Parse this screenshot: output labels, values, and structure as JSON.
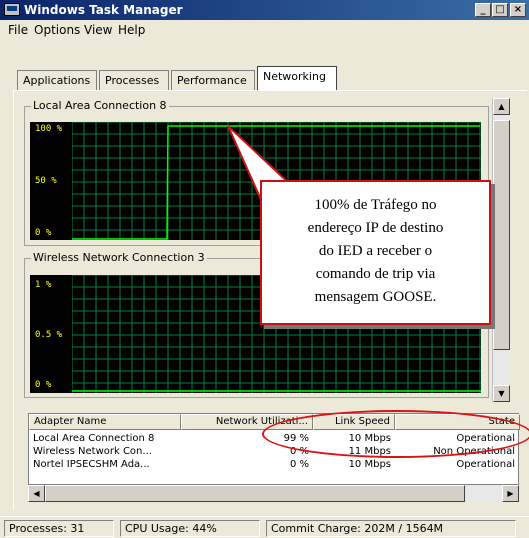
{
  "window": {
    "title": "Windows Task Manager",
    "minimize_label": "_",
    "maximize_label": "□",
    "close_label": "×"
  },
  "menu": [
    "File",
    "Options",
    "View",
    "Help"
  ],
  "tabs": [
    {
      "label": "Applications",
      "active": false
    },
    {
      "label": "Processes",
      "active": false
    },
    {
      "label": "Performance",
      "active": false
    },
    {
      "label": "Networking",
      "active": true
    }
  ],
  "graphs": [
    {
      "title": "Local Area Connection 8",
      "y_labels": [
        "100 %",
        "50 %",
        "0 %"
      ],
      "line_color": "#00ff00",
      "grid_color": "#008040"
    },
    {
      "title": "Wireless Network Connection 3",
      "y_labels": [
        "1 %",
        "0.5 %",
        "0 %"
      ],
      "line_color": "#00ff00",
      "grid_color": "#008040"
    }
  ],
  "callout": {
    "text_lines": [
      "100% de Tráfego no",
      "endereço IP de destino",
      "do IED a receber o",
      "comando de trip via",
      "mensagem GOOSE."
    ],
    "border_color": "#cc1111"
  },
  "adapter_table": {
    "columns": [
      "Adapter Name",
      "Network Utilizati...",
      "Link Speed",
      "State"
    ],
    "rows": [
      {
        "name": "Local Area Connection 8",
        "utilization": "99 %",
        "speed": "10 Mbps",
        "state": "Operational"
      },
      {
        "name": "Wireless Network Con...",
        "utilization": "0 %",
        "speed": "11 Mbps",
        "state": "Non Operational"
      },
      {
        "name": "Nortel IPSECSHM Ada...",
        "utilization": "0 %",
        "speed": "10 Mbps",
        "state": "Operational"
      }
    ]
  },
  "status": {
    "processes": "Processes: 31",
    "cpu": "CPU Usage: 44%",
    "commit": "Commit Charge: 202M / 1564M"
  }
}
